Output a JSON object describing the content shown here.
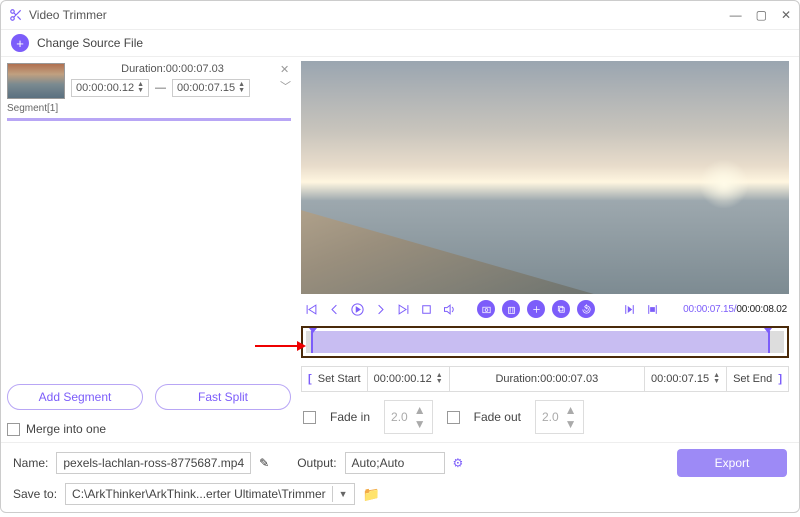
{
  "title": "Video Trimmer",
  "changeSource": "Change Source File",
  "segment": {
    "label": "Segment[1]",
    "durationLabel": "Duration:00:00:07.03",
    "start": "00:00:00.12",
    "end": "00:00:07.15"
  },
  "dash": "—",
  "addSegment": "Add Segment",
  "fastSplit": "Fast Split",
  "mergeLabel": "Merge into one",
  "time": {
    "current": "00:00:07.15",
    "total": "00:00:08.02"
  },
  "setStart": "Set Start",
  "setEnd": "Set End",
  "startVal": "00:00:00.12",
  "durVal": "Duration:00:00:07.03",
  "endVal": "00:00:07.15",
  "fadeIn": "Fade in",
  "fadeOut": "Fade out",
  "fadeVal": "2.0",
  "nameLabel": "Name:",
  "nameVal": "pexels-lachlan-ross-8775687.mp4",
  "outputLabel": "Output:",
  "outputVal": "Auto;Auto",
  "saveLabel": "Save to:",
  "saveVal": "C:\\ArkThinker\\ArkThink...erter Ultimate\\Trimmer",
  "export": "Export",
  "brackets": {
    "l": "[",
    "r": "]"
  }
}
